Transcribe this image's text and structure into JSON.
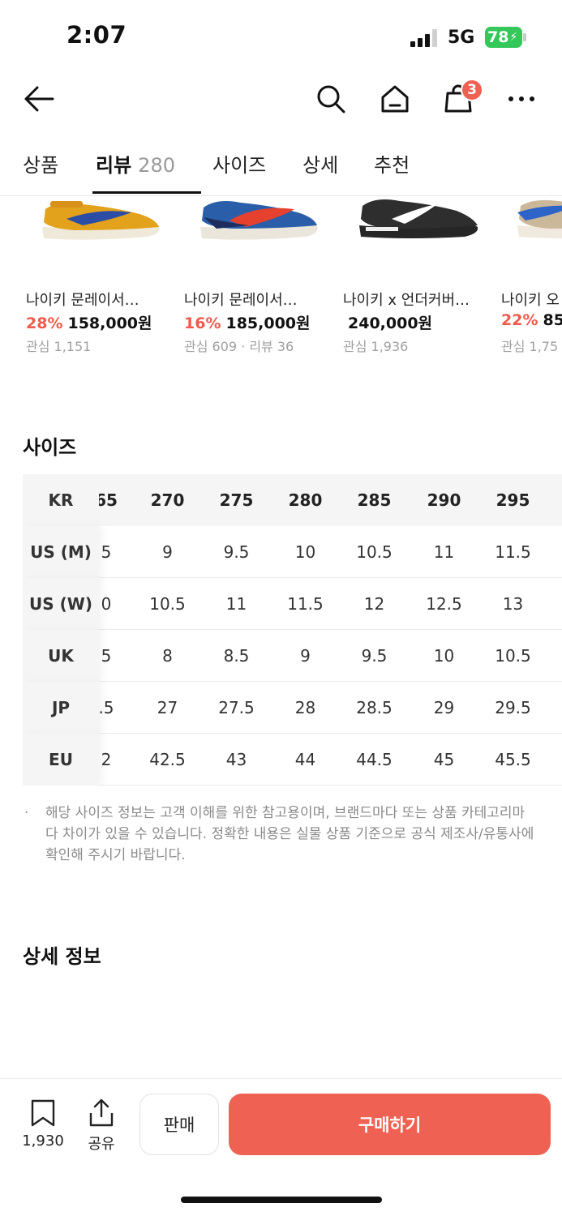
{
  "status_bar": {
    "time": "2:07",
    "network": "5G",
    "battery": "78"
  },
  "nav": {
    "cart_count": "3"
  },
  "tabs": [
    {
      "label": "상품"
    },
    {
      "label": "리뷰",
      "count": "280"
    },
    {
      "label": "사이즈"
    },
    {
      "label": "상세"
    },
    {
      "label": "추천"
    }
  ],
  "products": [
    {
      "name": "나이키 문레이서…",
      "discount": "28%",
      "price": "158,000원",
      "meta": "관심 1,151"
    },
    {
      "name": "나이키 문레이서…",
      "discount": "16%",
      "price": "185,000원",
      "meta": "관심 609 · 리뷰 36"
    },
    {
      "name": "나이키 x 언더커버…",
      "discount": "",
      "price": "240,000원",
      "meta": "관심 1,936"
    },
    {
      "name": "나이키 오",
      "discount": "22%",
      "price": "85",
      "meta": "관심 1,75"
    }
  ],
  "size_section": {
    "title": "사이즈",
    "rows": [
      {
        "label": "KR",
        "values": [
          "65",
          "270",
          "275",
          "280",
          "285",
          "290",
          "295"
        ]
      },
      {
        "label": "US (M)",
        "values": [
          "5",
          "9",
          "9.5",
          "10",
          "10.5",
          "11",
          "11.5"
        ]
      },
      {
        "label": "US (W)",
        "values": [
          "0",
          "10.5",
          "11",
          "11.5",
          "12",
          "12.5",
          "13"
        ]
      },
      {
        "label": "UK",
        "values": [
          "5",
          "8",
          "8.5",
          "9",
          "9.5",
          "10",
          "10.5"
        ]
      },
      {
        "label": "JP",
        "values": ".5",
        "values_full": []
      },
      {
        "label": "EU",
        "values": [
          "2",
          "42.5",
          "43",
          "44",
          "44.5",
          "45",
          "45.5"
        ]
      }
    ],
    "jp_values": [
      ".5",
      "27",
      "27.5",
      "28",
      "28.5",
      "29",
      "29.5"
    ],
    "notice": "해당 사이즈 정보는 고객 이해를 위한 참고용이며, 브랜드마다 또는 상품 카테고리마다 차이가 있을 수 있습니다. 정확한 내용은 실물 상품 기준으로 공식 제조사/유통사에 확인해 주시기 바랍니다."
  },
  "detail_section": {
    "title": "상세 정보"
  },
  "bottom_bar": {
    "bookmark_count": "1,930",
    "share_label": "공유",
    "sell_label": "판매",
    "buy_label": "구매하기"
  }
}
